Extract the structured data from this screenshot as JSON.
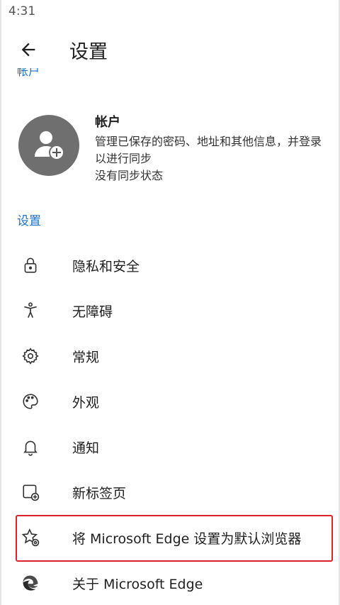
{
  "status_bar": {
    "time": "4:31"
  },
  "app_bar": {
    "title": "设置"
  },
  "top_section": {
    "label": "帐户"
  },
  "account": {
    "title": "帐户",
    "description": "管理已保存的密码、地址和其他信息，并登录以进行同步",
    "sync_status": "没有同步状态"
  },
  "settings_section": {
    "label": "设置"
  },
  "items": [
    {
      "label": "隐私和安全",
      "icon": "lock-icon"
    },
    {
      "label": "无障碍",
      "icon": "accessibility-icon"
    },
    {
      "label": "常规",
      "icon": "gear-icon"
    },
    {
      "label": "外观",
      "icon": "palette-icon"
    },
    {
      "label": "通知",
      "icon": "bell-icon"
    },
    {
      "label": "新标签页",
      "icon": "new-tab-icon"
    },
    {
      "label": "将 Microsoft Edge 设置为默认浏览器",
      "icon": "star-gear-icon"
    },
    {
      "label": "关于 Microsoft Edge",
      "icon": "edge-logo-icon"
    }
  ],
  "colors": {
    "accent": "#1a73c8",
    "highlight": "#e0202a",
    "avatar": "#6f6f6f"
  }
}
